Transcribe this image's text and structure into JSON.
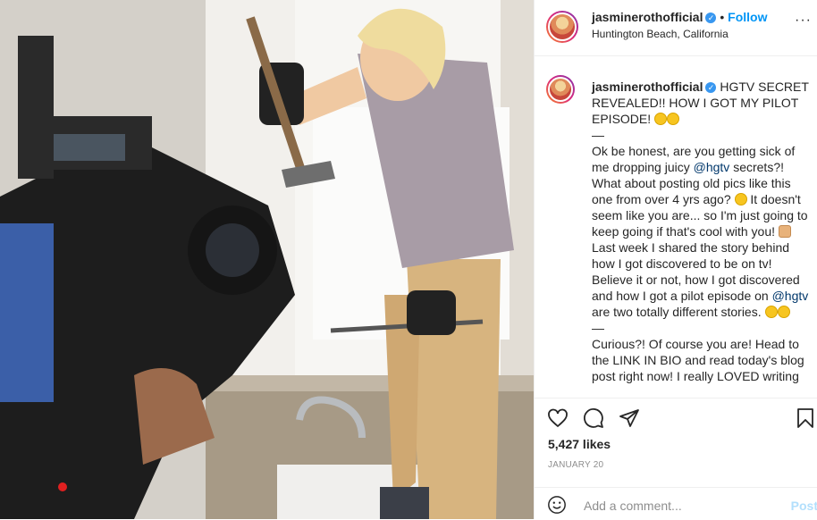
{
  "post": {
    "username": "jasminerothofficial",
    "verified_mark": "✓",
    "follow_separator": "•",
    "follow_label": "Follow",
    "location": "Huntington Beach, California",
    "more_label": "···"
  },
  "caption": {
    "username": "jasminerothofficial",
    "headline": "HGTV SECRET REVEALED!! HOW I GOT MY PILOT EPISODE!",
    "dash1": "—",
    "p1a": "Ok be honest, are you getting sick of me dropping juicy ",
    "mention1": "@hgtv",
    "p1b": " secrets?! What about posting old pics like this one from over 4 yrs ago? ",
    "p1c": " It doesn't seem like you are... so I'm just going to keep going if that's cool with you! ",
    "p1d": " Last week I shared the story behind how I got discovered to be on tv! Believe it or not, how I got discovered and how I got a pilot episode on ",
    "mention2": "@hgtv",
    "p1e": " are two totally different stories.",
    "dash2": "—",
    "p2": "Curious?! Of course you are! Head to the LINK IN BIO and read today's blog post right now! I really LOVED writing"
  },
  "engagement": {
    "likes": "5,427 likes",
    "date": "JANUARY 20"
  },
  "comment_box": {
    "placeholder": "Add a comment...",
    "post_label": "Post"
  },
  "icons": {
    "like": "heart-icon",
    "comment": "comment-icon",
    "share": "share-icon",
    "save": "bookmark-icon",
    "emoji": "smiley-icon"
  },
  "colors": {
    "link_blue": "#0095f6",
    "verified_blue": "#3897f0",
    "mention": "#00376b",
    "muted": "#8e8e8e"
  }
}
